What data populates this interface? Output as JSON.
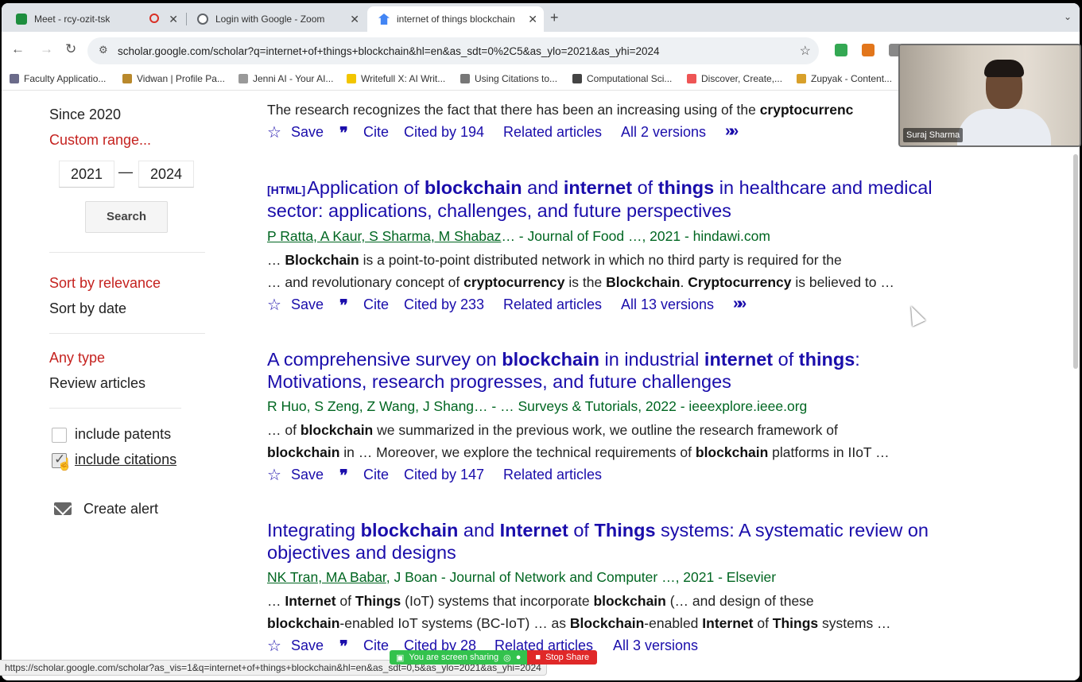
{
  "tabs": [
    {
      "title": "Meet - rcy-ozit-tsk",
      "icon": "google-meet-icon",
      "color": "#1e8e3e"
    },
    {
      "title": "Login with Google - Zoom",
      "icon": "globe-icon",
      "color": "#5f6368"
    },
    {
      "title": "internet of things blockchain",
      "icon": "scholar-icon",
      "color": "#4285f4"
    }
  ],
  "toolbar": {
    "url": "scholar.google.com/scholar?q=internet+of+things+blockchain&hl=en&as_sdt=0%2C5&as_ylo=2021&as_yhi=2024"
  },
  "bookmarks": [
    "Faculty Applicatio...",
    "Vidwan | Profile Pa...",
    "Jenni AI - Your AI...",
    "Writefull X: AI Writ...",
    "Using Citations to...",
    "Computational Sci...",
    "Discover, Create,...",
    "Zupyak - Content..."
  ],
  "sidebar": {
    "since": "Since 2020",
    "custom_range": "Custom range...",
    "year_from": "2021",
    "dash": "—",
    "year_to": "2024",
    "search_label": "Search",
    "sort_relevance": "Sort by relevance",
    "sort_date": "Sort by date",
    "any_type": "Any type",
    "review_articles": "Review articles",
    "include_patents": "include patents",
    "include_citations": "include citations",
    "include_patents_checked": false,
    "include_citations_checked": true,
    "create_alert": "Create alert"
  },
  "results": {
    "top_snippet": "The research recognizes the fact that there has been an increasing using of the",
    "top_snippet_bold": "cryptocurrenc",
    "top_actions": {
      "save": "Save",
      "cite": "Cite",
      "cited_by": "Cited by 194",
      "related": "Related articles",
      "versions": "All 2 versions"
    },
    "r1": {
      "tag": "[HTML]",
      "title_line2": "sector: applications, challenges, and future perspectives",
      "authors_linked": "P Ratta, A Kaur, S Sharma, M Shabaz",
      "meta_rest": "… - Journal of Food …, 2021 - hindawi.com",
      "snip1_rest": " is a point-to-point distributed network in which no third party is required for the",
      "snip2_a": "… and revolutionary concept of ",
      "snip2_b": " is the ",
      "snip2_c": ". ",
      "snip2_d": " is believed to …",
      "actions": {
        "save": "Save",
        "cite": "Cite",
        "cited_by": "Cited by 233",
        "related": "Related articles",
        "versions": "All 13 versions"
      }
    },
    "r2": {
      "title_a": "A comprehensive survey on ",
      "title_line2": "Motivations, research progresses, and future challenges",
      "meta": "R Huo, S Zeng, Z Wang, J Shang… - … Surveys & Tutorials, 2022 - ieeexplore.ieee.org",
      "snip1_rest": " we summarized in the previous work, we outline the research framework of",
      "snip2_rest": " in … Moreover, we explore the technical requirements of ",
      "snip2_end": " platforms in IIoT …",
      "actions": {
        "save": "Save",
        "cite": "Cite",
        "cited_by": "Cited by 147",
        "related": "Related articles"
      }
    },
    "r3": {
      "title_end": " systems: A systematic review on",
      "title_line2": "objectives and designs",
      "authors_linked": "NK Tran, MA Babar",
      "meta_rest": ", J Boan - Journal of Network and Computer …, 2021 - Elsevier",
      "snip1_a": "(IoT) systems that incorporate ",
      "snip1_b": " (… and design of these",
      "snip2_a": "-enabled IoT systems (BC-IoT) … as ",
      "snip2_b": "-enabled ",
      "snip2_c": " systems …",
      "actions": {
        "save": "Save",
        "cite": "Cite",
        "cited_by": "Cited by 28",
        "related": "Related articles",
        "versions": "All 3 versions"
      }
    }
  },
  "video": {
    "participant": "Suraj Sharma"
  },
  "status_url": "https://scholar.google.com/scholar?as_vis=1&q=internet+of+things+blockchain&hl=en&as_sdt=0,5&as_ylo=2021&as_yhi=2024",
  "share_bar": {
    "sharing": "You are screen sharing",
    "stop": "Stop Share"
  }
}
